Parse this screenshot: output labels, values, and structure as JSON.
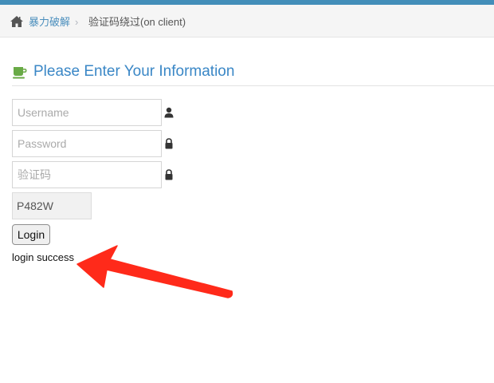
{
  "breadcrumb": {
    "home_icon": "home-icon",
    "home_label": "暴力破解",
    "separator": "›",
    "current_label": "验证码绕过(on client)"
  },
  "page": {
    "title_icon": "coffee-cup-icon",
    "title": "Please Enter Your Information"
  },
  "form": {
    "username_placeholder": "Username",
    "password_placeholder": "Password",
    "vcode_placeholder": "验证码",
    "username_icon": "user-icon",
    "password_icon": "lock-icon",
    "vcode_icon": "lock-icon",
    "captcha_value": "P482W",
    "login_label": "Login"
  },
  "result": {
    "message": "login success"
  },
  "annotation": {
    "arrow_color": "#ff2a1a"
  },
  "colors": {
    "accent": "#438eb9",
    "title": "#3a87c6",
    "link": "#4c8fbd",
    "cup": "#69aa46"
  }
}
